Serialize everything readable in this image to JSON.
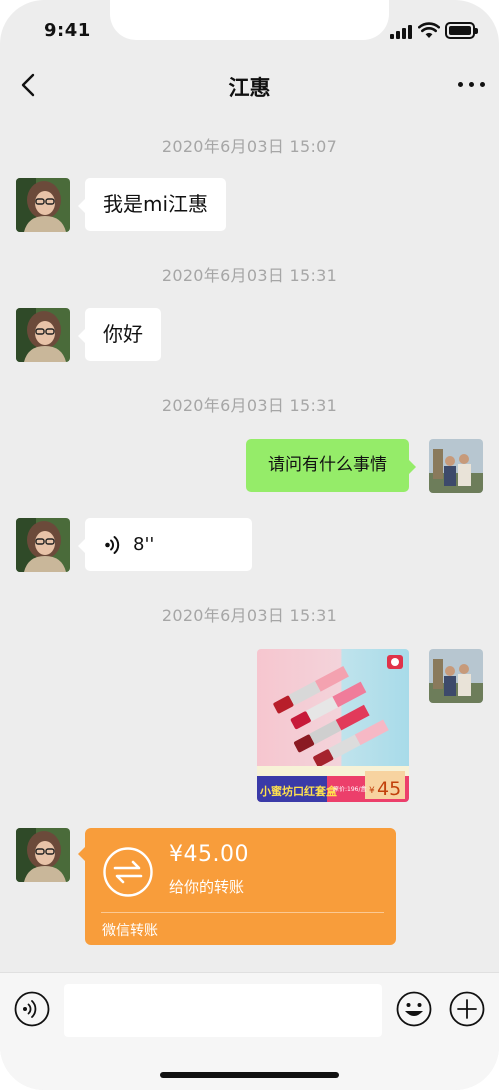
{
  "status_bar": {
    "time": "9:41"
  },
  "nav": {
    "title": "江惠"
  },
  "messages": {
    "ts1": "2020年6月03日 15:07",
    "m1": "我是mi江惠",
    "ts2": "2020年6月03日 15:31",
    "m2": "你好",
    "ts3": "2020年6月03日 15:31",
    "m3": "请问有什么事情",
    "m4_duration": "8''",
    "ts4": "2020年6月03日 15:31"
  },
  "product_image": {
    "title": "小蜜坊口红套盒",
    "price": "45",
    "price_symbol": "¥",
    "original_price": "原价:196/盒"
  },
  "transfer": {
    "amount": "¥45.00",
    "description": "给你的转账",
    "footer": "微信转账"
  },
  "input_bar": {
    "placeholder": ""
  },
  "colors": {
    "background": "#ededed",
    "outgoing_bubble": "#95ec69",
    "incoming_bubble": "#ffffff",
    "transfer_card": "#f89d3b",
    "timestamp_text": "#a6a6a6"
  },
  "icons": [
    "back-icon",
    "more-icon",
    "voice-icon",
    "transfer-icon",
    "voice-input-icon",
    "emoji-icon",
    "plus-icon"
  ]
}
